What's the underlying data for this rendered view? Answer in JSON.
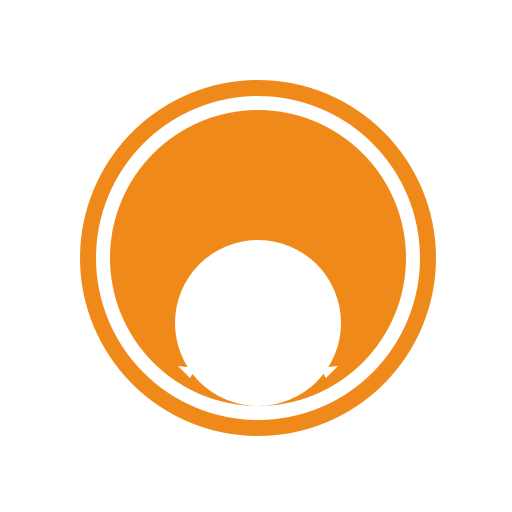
{
  "logo": {
    "icon": "orange-circle-emblem-icon",
    "colors": {
      "primary": "#EF8A1A",
      "background": "#FFFFFF"
    }
  }
}
